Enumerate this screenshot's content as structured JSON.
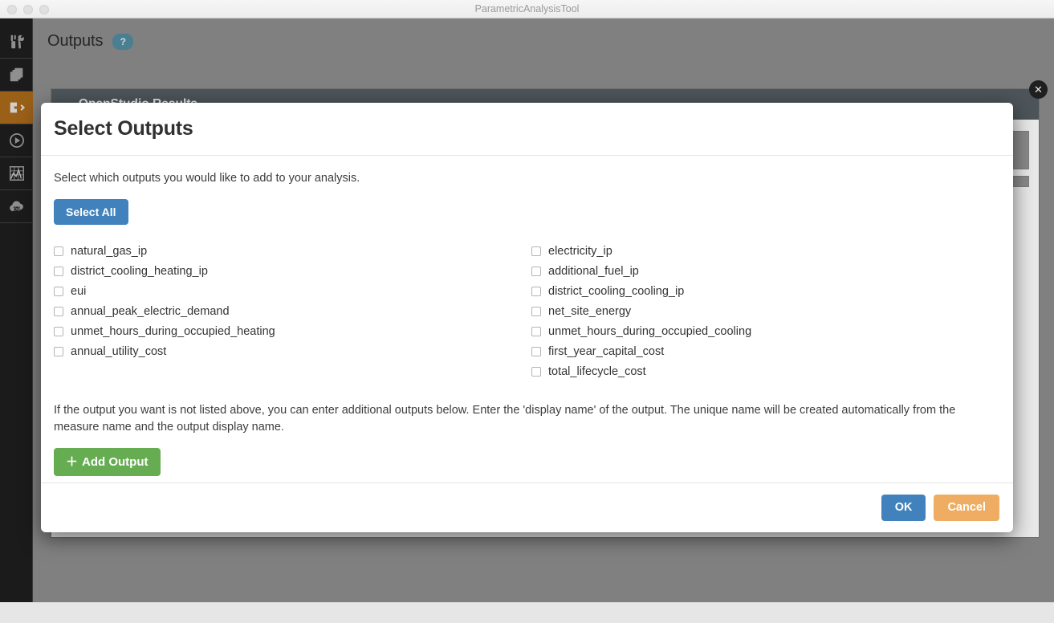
{
  "window": {
    "title": "ParametricAnalysisTool",
    "traffic_lights": [
      "close",
      "minimize",
      "zoom"
    ]
  },
  "sidebar": {
    "items": [
      {
        "name": "measures",
        "icon": "tools-icon",
        "active": false
      },
      {
        "name": "duplicate",
        "icon": "copy-layers-icon",
        "active": false
      },
      {
        "name": "outputs",
        "icon": "export-arrow-icon",
        "active": true
      },
      {
        "name": "run",
        "icon": "play-icon",
        "active": false
      },
      {
        "name": "results",
        "icon": "chart-grid-icon",
        "active": false
      },
      {
        "name": "cloud",
        "icon": "cloud-os-icon",
        "active": false
      }
    ]
  },
  "page": {
    "title": "Outputs",
    "help_badge": "?"
  },
  "results_panel": {
    "title": "OpenStudio Results",
    "collapse_icon": "⌄",
    "close_icon": "✕"
  },
  "modal": {
    "title": "Select Outputs",
    "intro": "Select which outputs you would like to add to your analysis.",
    "select_all_label": "Select All",
    "note": "If the output you want is not listed above, you can enter additional outputs below. Enter the 'display name' of the output. The unique name will be created automatically from the measure name and the output display name.",
    "add_output_label": "Add Output",
    "add_output_icon": "＋",
    "ok_label": "OK",
    "cancel_label": "Cancel",
    "outputs_left": [
      {
        "label": "natural_gas_ip",
        "checked": false
      },
      {
        "label": "district_cooling_heating_ip",
        "checked": false
      },
      {
        "label": "eui",
        "checked": false
      },
      {
        "label": "annual_peak_electric_demand",
        "checked": false
      },
      {
        "label": "unmet_hours_during_occupied_heating",
        "checked": false
      },
      {
        "label": "annual_utility_cost",
        "checked": false
      }
    ],
    "outputs_right": [
      {
        "label": "electricity_ip",
        "checked": false
      },
      {
        "label": "additional_fuel_ip",
        "checked": false
      },
      {
        "label": "district_cooling_cooling_ip",
        "checked": false
      },
      {
        "label": "net_site_energy",
        "checked": false
      },
      {
        "label": "unmet_hours_during_occupied_cooling",
        "checked": false
      },
      {
        "label": "first_year_capital_cost",
        "checked": false
      },
      {
        "label": "total_lifecycle_cost",
        "checked": false
      }
    ]
  },
  "colors": {
    "accent_blue": "#4182bd",
    "accent_green": "#66ad52",
    "accent_orange": "#eead62",
    "rail_active": "#9a6018",
    "panel_header": "#4d555a",
    "help_badge": "#4a7f92",
    "workspace_bg": "#808080"
  }
}
